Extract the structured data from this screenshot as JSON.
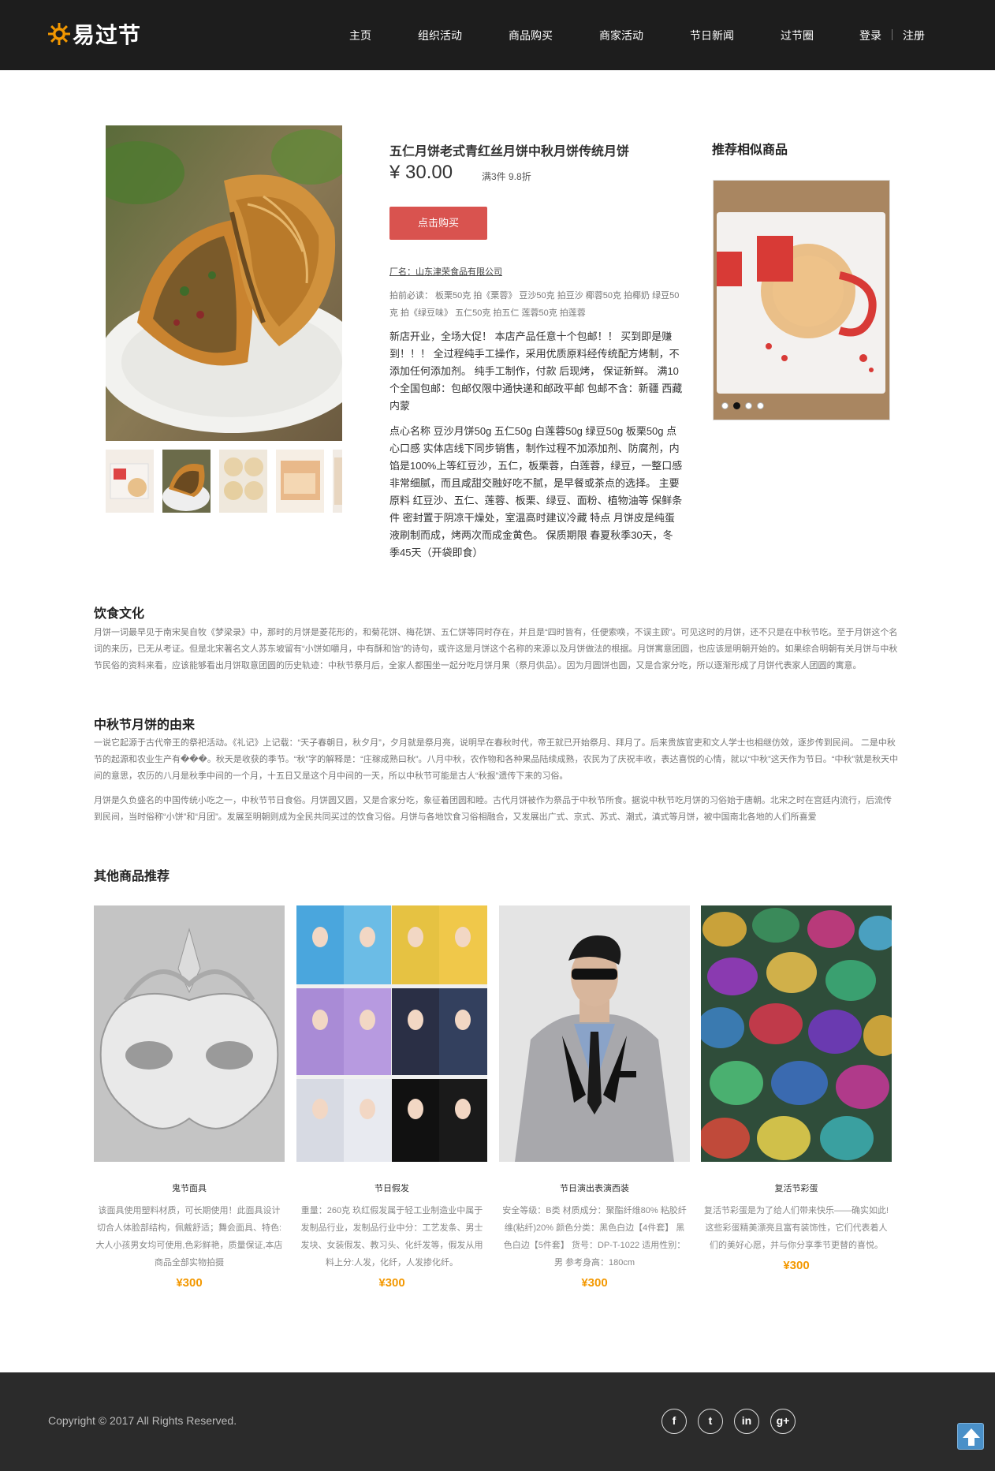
{
  "header": {
    "logo_text": "易过节",
    "nav": [
      {
        "label": "主页"
      },
      {
        "label": "组织活动"
      },
      {
        "label": "商品购买"
      },
      {
        "label": "商家活动"
      },
      {
        "label": "节日新闻"
      },
      {
        "label": "过节圈"
      }
    ],
    "login": "登录",
    "register": "注册"
  },
  "product": {
    "title": "五仁月饼老式青红丝月饼中秋月饼传统月饼",
    "price": "¥ 30.00",
    "discount": "满3件 9.8折",
    "buy_label": "点击购买",
    "factory": "厂名：山东津荣食品有限公司",
    "pre_note": "拍前必读：  板栗50克 拍《栗蓉》 豆沙50克 拍豆沙 椰蓉50克 拍椰奶 绿豆50克 拍《绿豆味》 五仁50克 拍五仁 莲蓉50克 拍莲蓉",
    "promo": "新店开业，全场大促！ 本店产品任意十个包邮！！ 买到即是赚到！！！ 全过程纯手工操作，采用优质原料经传统配方烤制，不添加任何添加剂。 纯手工制作，付款 后现烤， 保证新鲜。  满10个全国包邮：包邮仅限中通快递和邮政平邮 包邮不含：新疆 西藏 内蒙",
    "detail": "点心名称 豆沙月饼50g 五仁50g 白莲蓉50g 绿豆50g 板栗50g 点心口感 实体店线下同步销售，制作过程不加添加剂、防腐剂，内馅是100%上等红豆沙，五仁，板栗蓉，白莲蓉，绿豆，一整口感非常细腻，而且咸甜交融好吃不腻，是早餐或茶点的选择。 主要原料 红豆沙、五仁、莲蓉、板栗、绿豆、面粉、植物油等 保鲜条件 密封置于阴凉干燥处，室温高时建议冷藏 特点 月饼皮是纯蛋液刷制而成，烤两次而成金黄色。 保质期限 春夏秋季30天，冬季45天（开袋即食）"
  },
  "recommend": {
    "title": "推荐相似商品",
    "slides": 4,
    "active_slide": 2
  },
  "articles": [
    {
      "heading": "饮食文化",
      "paragraphs": [
        "月饼一词最早见于南宋吴自牧《梦梁录》中，那时的月饼是菱花形的，和菊花饼、梅花饼、五仁饼等同时存在，并且是“四时皆有，任便索唤，不误主顾”。可见这时的月饼，还不只是在中秋节吃。至于月饼这个名词的来历，已无从考证。但是北宋著名文人苏东坡留有“小饼如嚼月，中有酥和饴”的诗句，或许这是月饼这个名称的来源以及月饼做法的根据。月饼寓意团圆，也应该是明朝开始的。如果综合明朝有关月饼与中秋节民俗的资料来看，应该能够看出月饼取意团圆的历史轨迹：中秋节祭月后，全家人都围坐一起分吃月饼月果（祭月供品）。因为月圆饼也圆，又是合家分吃，所以逐渐形成了月饼代表家人团圆的寓意。"
      ]
    },
    {
      "heading": "中秋节月饼的由来",
      "paragraphs": [
        "一说它起源于古代帝王的祭祀活动。《礼记》上记载：“天子春朝日，秋夕月”，夕月就是祭月亮，说明早在春秋时代，帝王就已开始祭月、拜月了。后来贵族官吏和文人学士也相继仿效，逐步传到民间。 二是中秋节的起源和农业生产有���。秋天是收获的季节。“秋”字的解释是：“庄稼成熟曰秋”。八月中秋，农作物和各种果品陆续成熟，农民为了庆祝丰收，表达喜悦的心情，就以“中秋”这天作为节日。“中秋”就是秋天中间的意思，农历的八月是秋季中间的一个月，十五日又是这个月中间的一天，所以中秋节可能是古人“秋报”遗传下来的习俗。",
        "月饼是久负盛名的中国传统小吃之一，中秋节节日食俗。月饼圆又圆，又是合家分吃，象征着团圆和睦。古代月饼被作为祭品于中秋节所食。据说中秋节吃月饼的习俗始于唐朝。北宋之时在宫廷内流行，后流传到民间，当时俗称“小饼”和“月团”。发展至明朝则成为全民共同买过的饮食习俗。月饼与各地饮食习俗相融合，又发展出广式、京式、苏式、潮式，滇式等月饼，被中国南北各地的人们所喜爱"
      ]
    }
  ],
  "others": {
    "heading": "其他商品推荐",
    "items": [
      {
        "name": "鬼节面具",
        "desc": "该面具使用塑料材质，可长期使用！此面具设计切合人体脸部结构，佩戴舒适；舞会面具、特色:大人小孩男女均可使用,色彩鲜艳，质量保证,本店商品全部实物拍摄",
        "price": "¥300"
      },
      {
        "name": "节日假发",
        "desc": "重量：260克 玖红假发属于轻工业制造业中属于发制品行业，发制品行业中分：工艺发条、男士发块、女装假发、教习头、化纤发等，假发从用料上分:人发，化纤，人发掺化纤。",
        "price": "¥300"
      },
      {
        "name": "节日演出表演西装",
        "desc": "安全等级：B类 材质成分：聚酯纤维80% 粘胶纤维(粘纤)20% 颜色分类：黑色白边【4件套】 黑色白边【5件套】 货号：DP-T-1022 适用性别：男 参考身高：180cm",
        "price": "¥300"
      },
      {
        "name": "复活节彩蛋",
        "desc": "复活节彩蛋是为了给人们带来快乐——确实如此!这些彩蛋精美漂亮且富有装饰性，它们代表着人们的美好心愿，并与你分享季节更替的喜悦。",
        "price": "¥300"
      }
    ]
  },
  "footer": {
    "copyright": "Copyright © 2017 All Rights Reserved.",
    "social": [
      "f",
      "t",
      "in",
      "g+"
    ]
  }
}
